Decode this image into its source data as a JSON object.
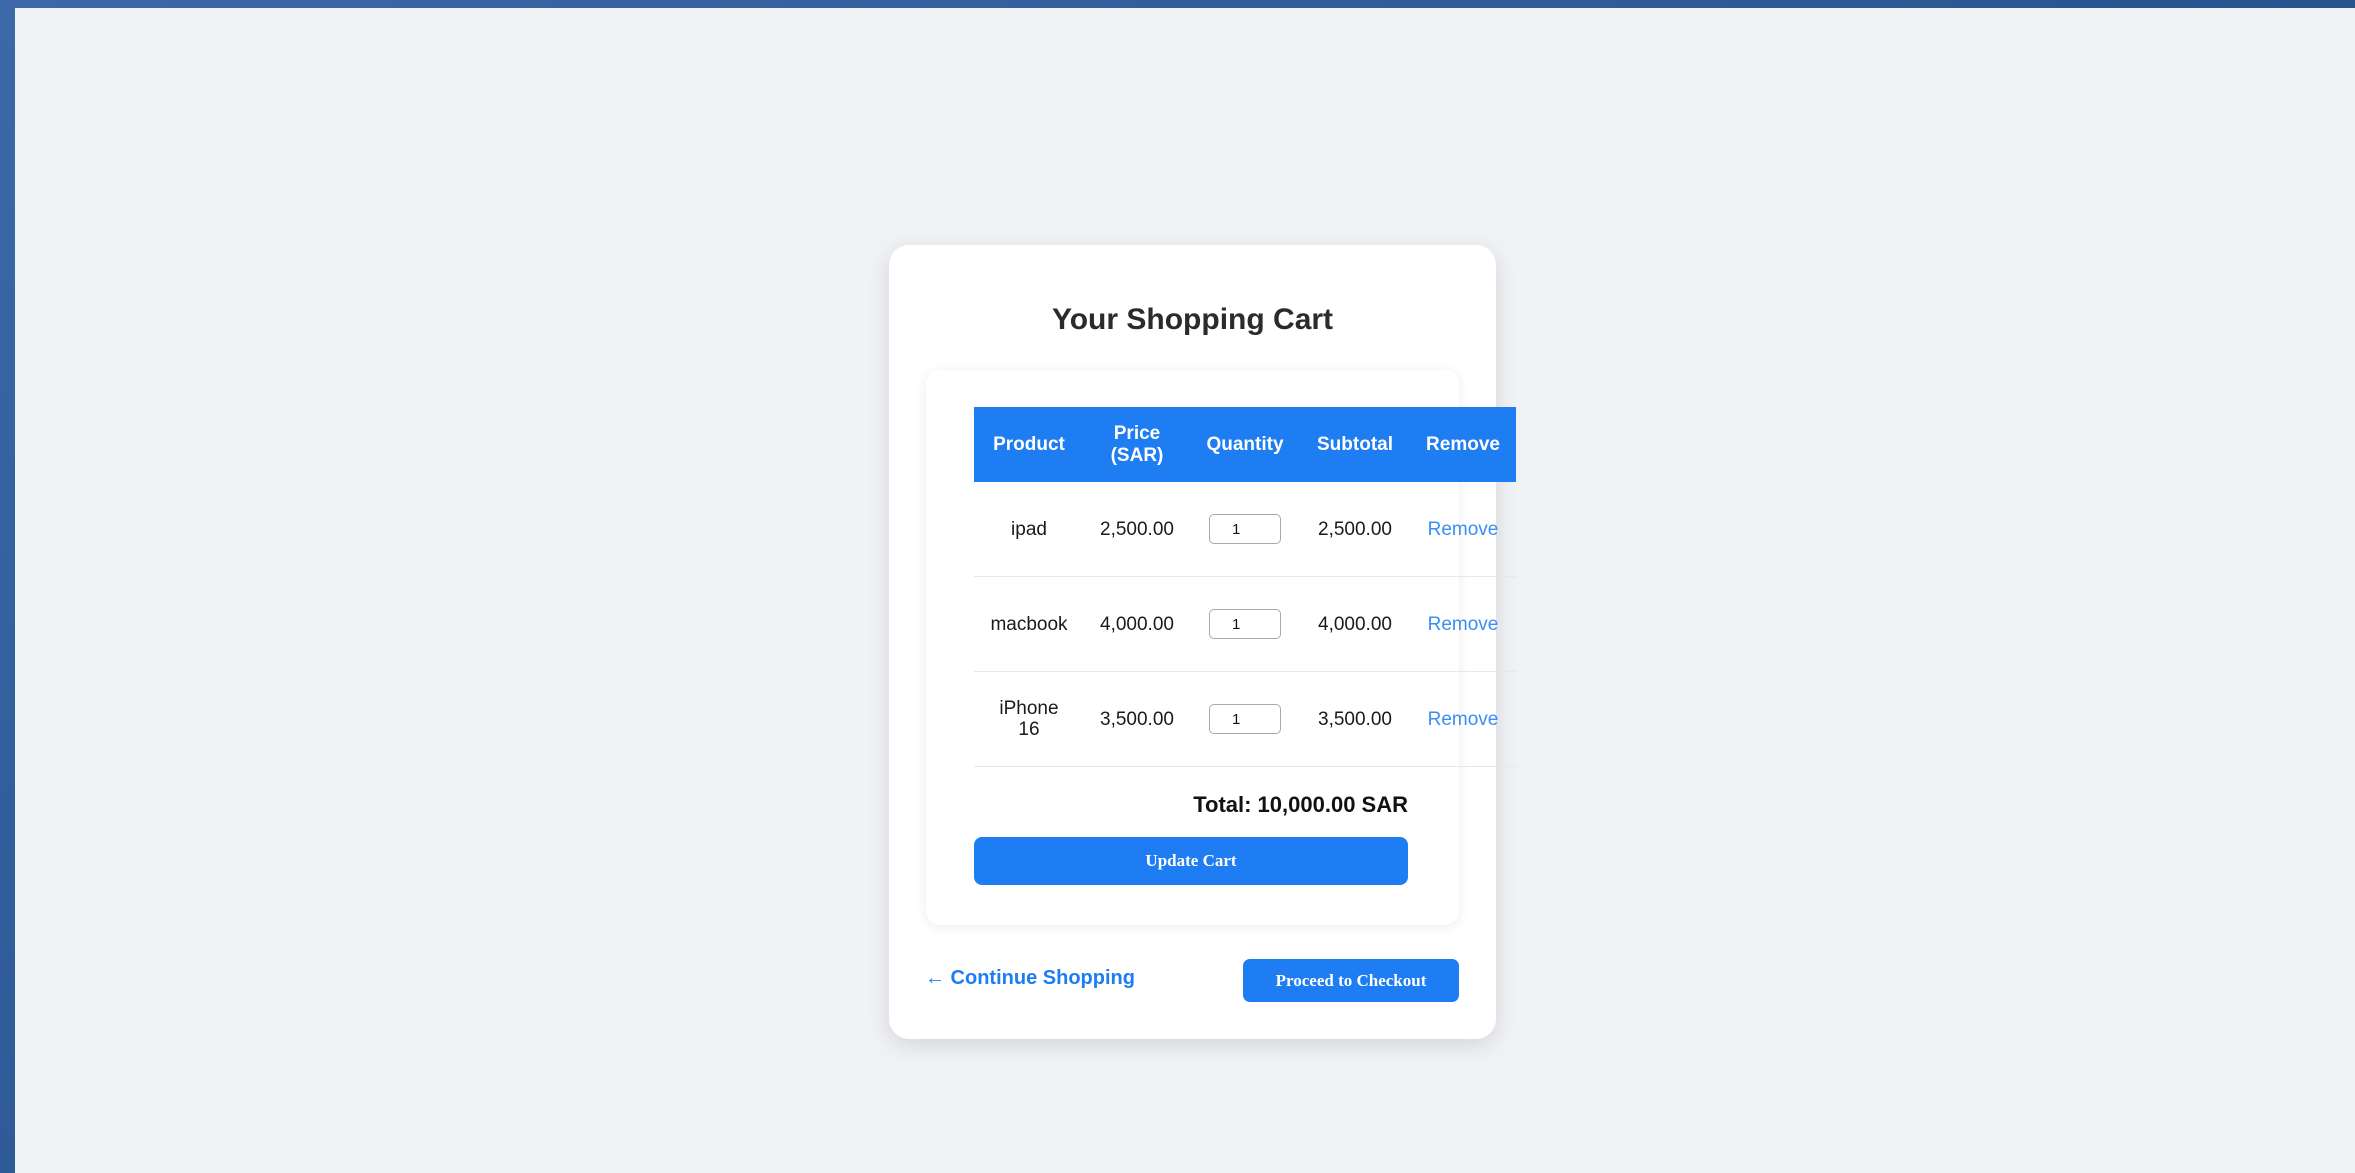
{
  "page": {
    "title": "Your Shopping Cart"
  },
  "table": {
    "headers": [
      "Product",
      "Price (SAR)",
      "Quantity",
      "Subtotal",
      "Remove"
    ],
    "rows": [
      {
        "product": "ipad",
        "price": "2,500.00",
        "quantity": "1",
        "subtotal": "2,500.00",
        "remove_label": "Remove"
      },
      {
        "product": "macbook",
        "price": "4,000.00",
        "quantity": "1",
        "subtotal": "4,000.00",
        "remove_label": "Remove"
      },
      {
        "product": "iPhone 16",
        "price": "3,500.00",
        "quantity": "1",
        "subtotal": "3,500.00",
        "remove_label": "Remove"
      }
    ]
  },
  "summary": {
    "total_text": "Total: 10,000.00 SAR"
  },
  "actions": {
    "update_label": "Update Cart",
    "continue_label": "← Continue Shopping",
    "checkout_label": "Proceed to Checkout"
  },
  "colors": {
    "accent": "#1e7df2",
    "link": "#3a8ef5",
    "background": "#f0f2f5",
    "frame": "#3a62a0"
  }
}
